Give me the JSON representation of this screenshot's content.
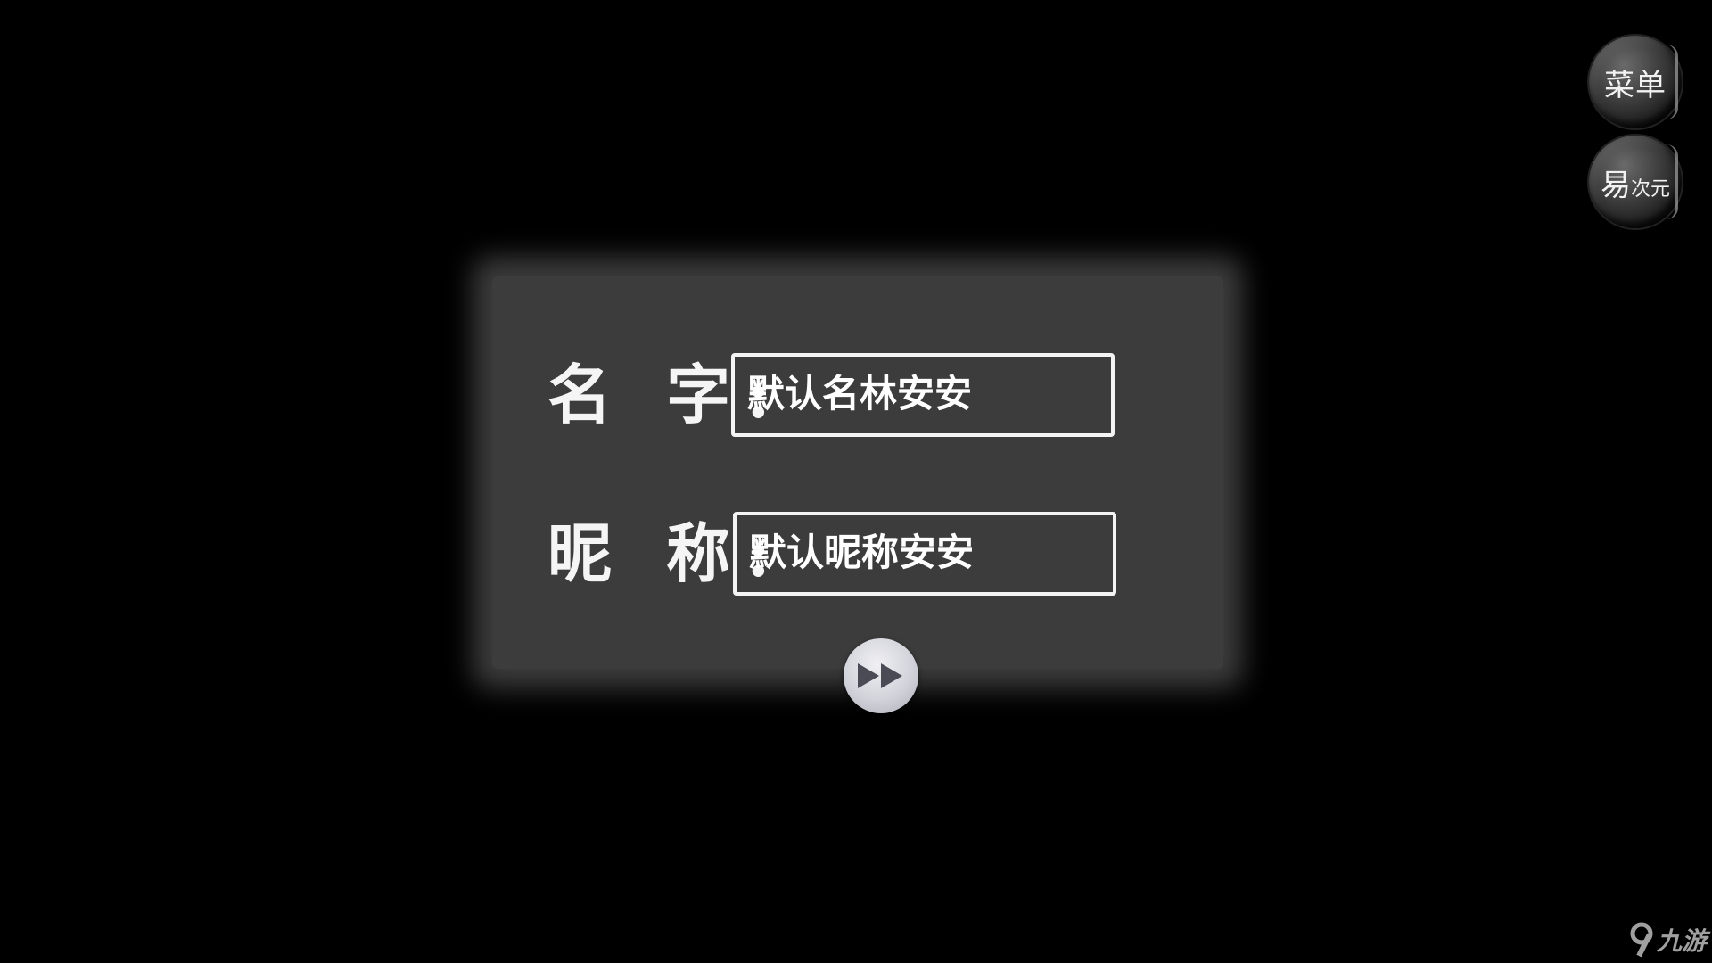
{
  "side_buttons": {
    "menu_label": "菜单",
    "brand_main": "易",
    "brand_sub": "次元"
  },
  "form": {
    "name_label": "名 字",
    "name_colon": ":",
    "name_value": "默认名林安安",
    "nickname_label": "昵 称",
    "nickname_colon": ":",
    "nickname_value": "默认昵称安安"
  },
  "confirm_icon": "fast-forward-icon",
  "watermark": {
    "logo_icon": "9game-logo-icon",
    "text": "九游"
  }
}
